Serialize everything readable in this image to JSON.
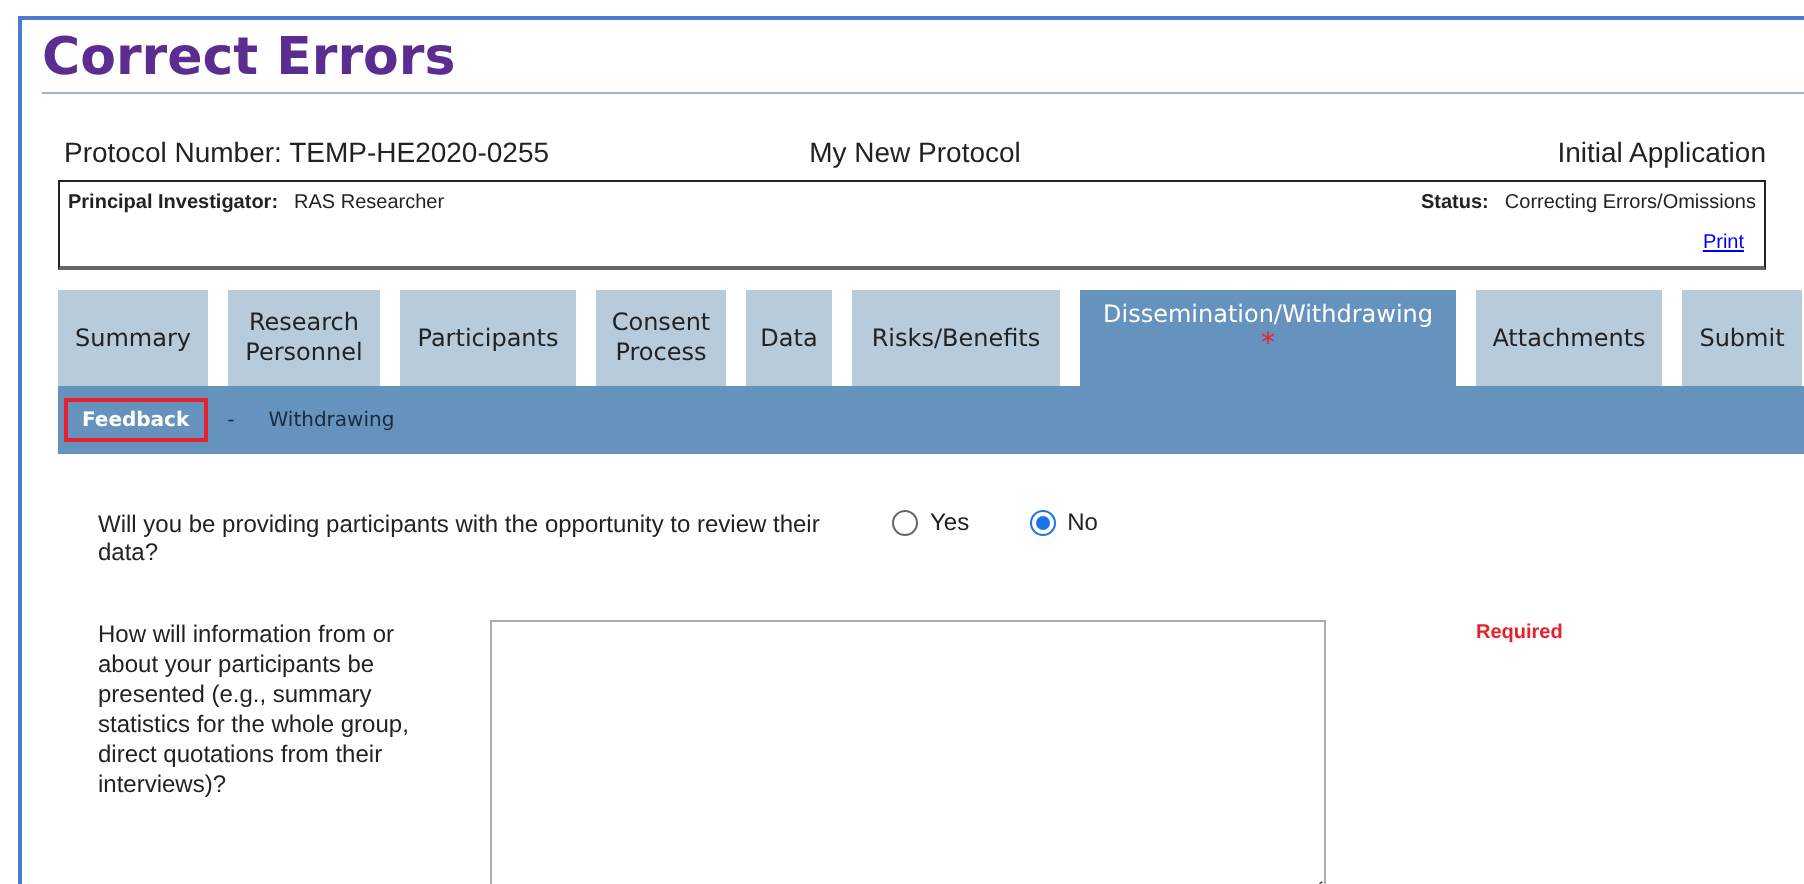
{
  "page_title": "Correct Errors",
  "protocol": {
    "number": "Protocol Number: TEMP-HE2020-0255",
    "name": "My New Protocol",
    "type": "Initial Application"
  },
  "info_box": {
    "pi_label": "Principal Investigator:",
    "pi_value": "RAS Researcher",
    "status_label": "Status:",
    "status_value": "Correcting Errors/Omissions",
    "print_link": "Print"
  },
  "tabs": [
    {
      "label": "Summary",
      "selected": false
    },
    {
      "label": "Research Personnel",
      "selected": false
    },
    {
      "label": "Participants",
      "selected": false
    },
    {
      "label": "Consent Process",
      "selected": false
    },
    {
      "label": "Data",
      "selected": false
    },
    {
      "label": "Risks/Benefits",
      "selected": false
    },
    {
      "label": "Dissemination/Withdrawing",
      "selected": true,
      "error_mark": "*"
    },
    {
      "label": "Attachments",
      "selected": false
    },
    {
      "label": "Submit",
      "selected": false
    }
  ],
  "subtabs": [
    {
      "label": "Feedback",
      "selected": true
    },
    {
      "label": "Withdrawing",
      "selected": false
    }
  ],
  "subtab_separator": "-",
  "questions": [
    {
      "kind": "radio",
      "label": "Will you be providing participants with the opportunity to review their data?",
      "options": [
        {
          "label": "Yes",
          "selected": false
        },
        {
          "label": "No",
          "selected": true
        }
      ]
    },
    {
      "kind": "textarea",
      "label": "How will information from or about your participants be presented (e.g., summary statistics for the whole group, direct quotations from their interviews)?",
      "required_note": "Required"
    }
  ]
}
